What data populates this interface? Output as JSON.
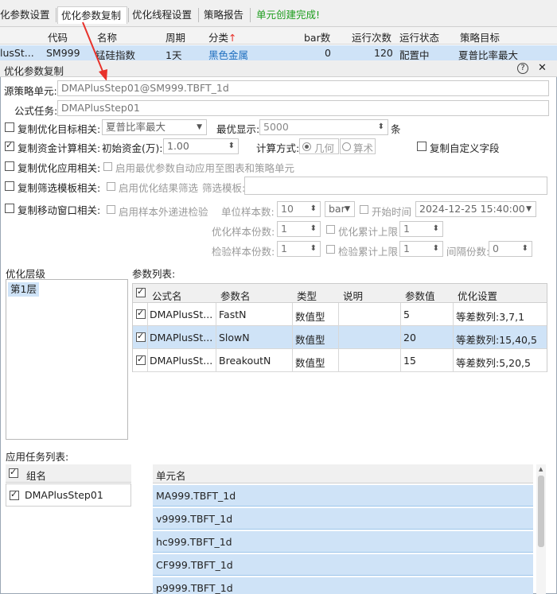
{
  "tabs": [
    {
      "label": "化参数设置"
    },
    {
      "label": "优化参数复制"
    },
    {
      "label": "优化线程设置"
    },
    {
      "label": "策略报告"
    },
    {
      "label": "单元创建完成!"
    }
  ],
  "strategy_table": {
    "headers": [
      "代码",
      "名称",
      "周期",
      "分类",
      "bar数",
      "运行次数",
      "运行状态",
      "策略目标"
    ],
    "sort_arrow": "↑",
    "row": {
      "unit": "lusSt...",
      "code": "SM999",
      "name": "锰硅指数",
      "period": "1天",
      "category": "黑色金属",
      "bar_count": "0",
      "run_count": "120",
      "status": "配置中",
      "target": "夏普比率最大"
    }
  },
  "dialog": {
    "title": "优化参数复制",
    "help_icon": "?",
    "close_icon": "✕",
    "source_unit_label": "源策略单元:",
    "source_unit_value": "DMAPlusStep01@SM999.TBFT_1d",
    "formula_task_label": "公式任务:",
    "formula_task_value": "DMAPlusStep01",
    "opt_target": {
      "label": "复制优化目标相关:",
      "checked": false,
      "value": "夏普比率最大",
      "best_label": "最优显示:",
      "best_value": "5000",
      "unit": "条"
    },
    "funds": {
      "label": "复制资金计算相关:",
      "checked": true,
      "initial_label": "初始资金(万):",
      "initial_value": "1.00",
      "method_label": "计算方式:",
      "method_geo": "几何",
      "method_arith": "算术",
      "custom_field_label": "复制自定义字段",
      "custom_checked": false
    },
    "apply": {
      "label": "复制优化应用相关:",
      "checked": false,
      "auto_label": "启用最优参数自动应用至图表和策略单元"
    },
    "filter": {
      "label": "复制筛选模板相关:",
      "checked": false,
      "enable_label": "启用优化结果筛选",
      "template_label": "筛选模板:",
      "template_value": ""
    },
    "moving": {
      "label": "复制移动窗口相关:",
      "checked": false,
      "sample_out_label": "启用样本外递进检验",
      "unit_sample_label": "单位样本数:",
      "unit_sample_value": "10",
      "unit_sample_unit": "bar",
      "start_time_label": "开始时间",
      "start_time_value": "2024-12-25 15:40:00",
      "opt_sample_label": "优化样本份数:",
      "opt_sample_value": "1",
      "opt_cum_label": "优化累计上限",
      "opt_cum_value": "1",
      "test_sample_label": "检验样本份数:",
      "test_sample_value": "1",
      "test_cum_label": "检验累计上限",
      "test_cum_value": "1",
      "interval_label": "间隔份数:",
      "interval_value": "0"
    },
    "levels": {
      "label": "优化层级",
      "items": [
        "第1层"
      ]
    },
    "params": {
      "label": "参数列表:",
      "headers": [
        "公式名",
        "参数名",
        "类型",
        "说明",
        "参数值",
        "优化设置"
      ],
      "rows": [
        {
          "formula": "DMAPlusSt...",
          "name": "FastN",
          "type": "数值型",
          "desc": "",
          "value": "5",
          "setting": "等差数列:3,7,1"
        },
        {
          "formula": "DMAPlusSt...",
          "name": "SlowN",
          "type": "数值型",
          "desc": "",
          "value": "20",
          "setting": "等差数列:15,40,5"
        },
        {
          "formula": "DMAPlusSt...",
          "name": "BreakoutN",
          "type": "数值型",
          "desc": "",
          "value": "15",
          "setting": "等差数列:5,20,5"
        }
      ]
    },
    "apply_tasks": {
      "label": "应用任务列表:",
      "group_header": "组名",
      "groups": [
        "DMAPlusStep01"
      ],
      "unit_header": "单元名",
      "units": [
        "MA999.TBFT_1d",
        "v9999.TBFT_1d",
        "hc999.TBFT_1d",
        "CF999.TBFT_1d",
        "p9999.TBFT_1d"
      ]
    }
  },
  "colors": {
    "accent": "#1f6fbf",
    "selection": "#cfe3f7",
    "annotation_arrow": "#e8322b",
    "success": "#1a9c1a"
  }
}
